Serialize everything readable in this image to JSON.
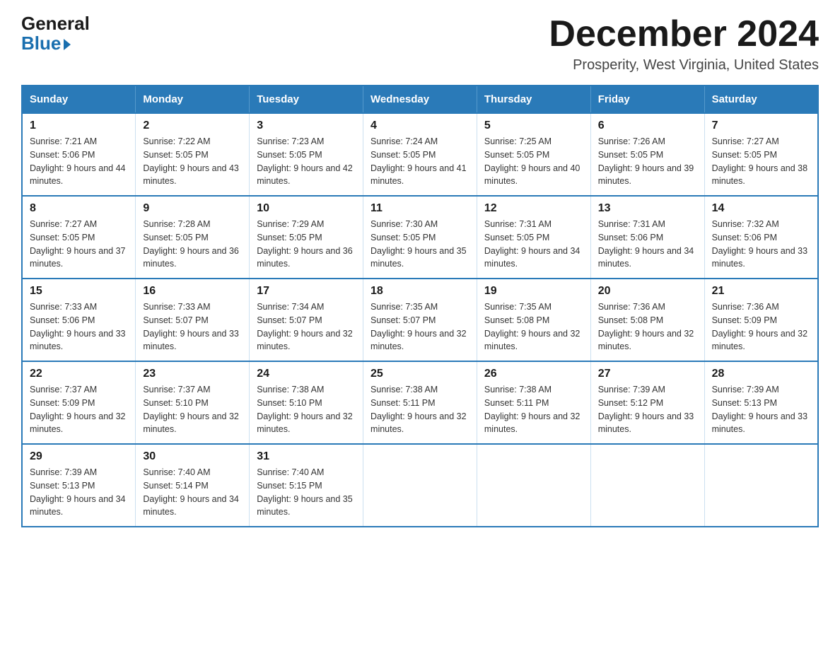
{
  "logo": {
    "general": "General",
    "blue": "Blue"
  },
  "header": {
    "month": "December 2024",
    "location": "Prosperity, West Virginia, United States"
  },
  "weekdays": [
    "Sunday",
    "Monday",
    "Tuesday",
    "Wednesday",
    "Thursday",
    "Friday",
    "Saturday"
  ],
  "weeks": [
    [
      {
        "day": "1",
        "sunrise": "7:21 AM",
        "sunset": "5:06 PM",
        "daylight": "9 hours and 44 minutes."
      },
      {
        "day": "2",
        "sunrise": "7:22 AM",
        "sunset": "5:05 PM",
        "daylight": "9 hours and 43 minutes."
      },
      {
        "day": "3",
        "sunrise": "7:23 AM",
        "sunset": "5:05 PM",
        "daylight": "9 hours and 42 minutes."
      },
      {
        "day": "4",
        "sunrise": "7:24 AM",
        "sunset": "5:05 PM",
        "daylight": "9 hours and 41 minutes."
      },
      {
        "day": "5",
        "sunrise": "7:25 AM",
        "sunset": "5:05 PM",
        "daylight": "9 hours and 40 minutes."
      },
      {
        "day": "6",
        "sunrise": "7:26 AM",
        "sunset": "5:05 PM",
        "daylight": "9 hours and 39 minutes."
      },
      {
        "day": "7",
        "sunrise": "7:27 AM",
        "sunset": "5:05 PM",
        "daylight": "9 hours and 38 minutes."
      }
    ],
    [
      {
        "day": "8",
        "sunrise": "7:27 AM",
        "sunset": "5:05 PM",
        "daylight": "9 hours and 37 minutes."
      },
      {
        "day": "9",
        "sunrise": "7:28 AM",
        "sunset": "5:05 PM",
        "daylight": "9 hours and 36 minutes."
      },
      {
        "day": "10",
        "sunrise": "7:29 AM",
        "sunset": "5:05 PM",
        "daylight": "9 hours and 36 minutes."
      },
      {
        "day": "11",
        "sunrise": "7:30 AM",
        "sunset": "5:05 PM",
        "daylight": "9 hours and 35 minutes."
      },
      {
        "day": "12",
        "sunrise": "7:31 AM",
        "sunset": "5:05 PM",
        "daylight": "9 hours and 34 minutes."
      },
      {
        "day": "13",
        "sunrise": "7:31 AM",
        "sunset": "5:06 PM",
        "daylight": "9 hours and 34 minutes."
      },
      {
        "day": "14",
        "sunrise": "7:32 AM",
        "sunset": "5:06 PM",
        "daylight": "9 hours and 33 minutes."
      }
    ],
    [
      {
        "day": "15",
        "sunrise": "7:33 AM",
        "sunset": "5:06 PM",
        "daylight": "9 hours and 33 minutes."
      },
      {
        "day": "16",
        "sunrise": "7:33 AM",
        "sunset": "5:07 PM",
        "daylight": "9 hours and 33 minutes."
      },
      {
        "day": "17",
        "sunrise": "7:34 AM",
        "sunset": "5:07 PM",
        "daylight": "9 hours and 32 minutes."
      },
      {
        "day": "18",
        "sunrise": "7:35 AM",
        "sunset": "5:07 PM",
        "daylight": "9 hours and 32 minutes."
      },
      {
        "day": "19",
        "sunrise": "7:35 AM",
        "sunset": "5:08 PM",
        "daylight": "9 hours and 32 minutes."
      },
      {
        "day": "20",
        "sunrise": "7:36 AM",
        "sunset": "5:08 PM",
        "daylight": "9 hours and 32 minutes."
      },
      {
        "day": "21",
        "sunrise": "7:36 AM",
        "sunset": "5:09 PM",
        "daylight": "9 hours and 32 minutes."
      }
    ],
    [
      {
        "day": "22",
        "sunrise": "7:37 AM",
        "sunset": "5:09 PM",
        "daylight": "9 hours and 32 minutes."
      },
      {
        "day": "23",
        "sunrise": "7:37 AM",
        "sunset": "5:10 PM",
        "daylight": "9 hours and 32 minutes."
      },
      {
        "day": "24",
        "sunrise": "7:38 AM",
        "sunset": "5:10 PM",
        "daylight": "9 hours and 32 minutes."
      },
      {
        "day": "25",
        "sunrise": "7:38 AM",
        "sunset": "5:11 PM",
        "daylight": "9 hours and 32 minutes."
      },
      {
        "day": "26",
        "sunrise": "7:38 AM",
        "sunset": "5:11 PM",
        "daylight": "9 hours and 32 minutes."
      },
      {
        "day": "27",
        "sunrise": "7:39 AM",
        "sunset": "5:12 PM",
        "daylight": "9 hours and 33 minutes."
      },
      {
        "day": "28",
        "sunrise": "7:39 AM",
        "sunset": "5:13 PM",
        "daylight": "9 hours and 33 minutes."
      }
    ],
    [
      {
        "day": "29",
        "sunrise": "7:39 AM",
        "sunset": "5:13 PM",
        "daylight": "9 hours and 34 minutes."
      },
      {
        "day": "30",
        "sunrise": "7:40 AM",
        "sunset": "5:14 PM",
        "daylight": "9 hours and 34 minutes."
      },
      {
        "day": "31",
        "sunrise": "7:40 AM",
        "sunset": "5:15 PM",
        "daylight": "9 hours and 35 minutes."
      },
      null,
      null,
      null,
      null
    ]
  ]
}
